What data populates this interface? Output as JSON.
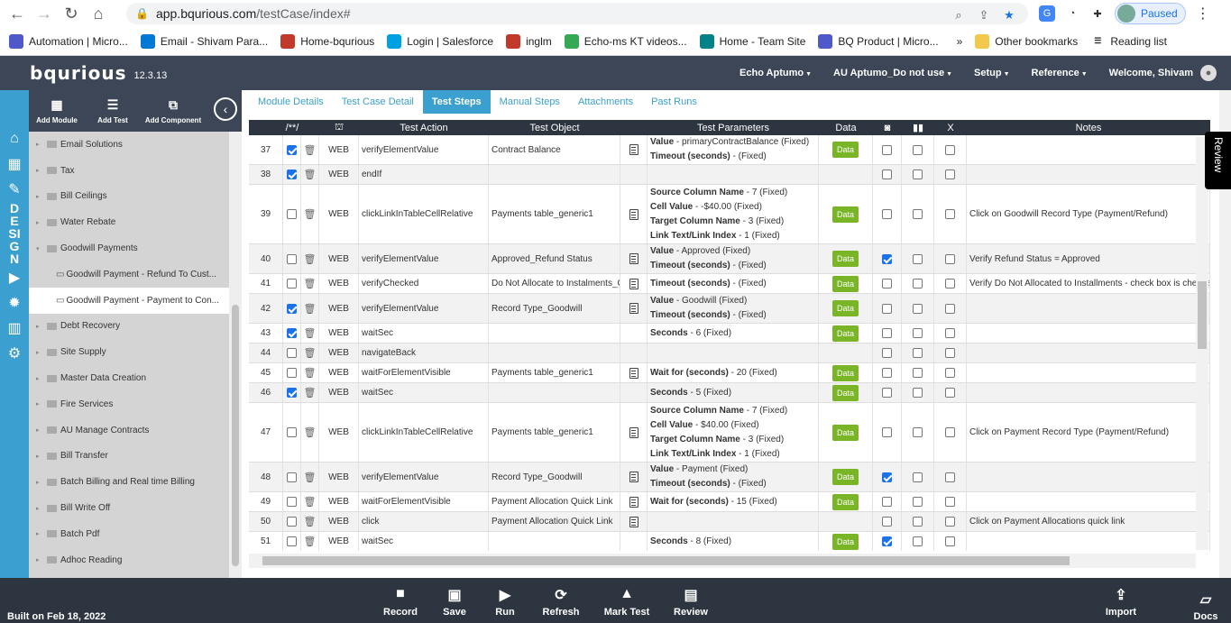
{
  "browser": {
    "url_host": "app.bqurious.com",
    "url_path": "/testCase/index#",
    "paused_label": "Paused"
  },
  "bookmarks": [
    {
      "label": "Automation | Micro...",
      "color": "#5059c9"
    },
    {
      "label": "Email - Shivam Para...",
      "color": "#0078d4"
    },
    {
      "label": "Home-bqurious",
      "color": "#c0392b"
    },
    {
      "label": "Login | Salesforce",
      "color": "#00a1e0"
    },
    {
      "label": "inglm",
      "color": "#c0392b"
    },
    {
      "label": "Echo-ms KT videos...",
      "color": "#34a853"
    },
    {
      "label": "Home - Team Site",
      "color": "#038387"
    },
    {
      "label": "BQ Product | Micro...",
      "color": "#5059c9"
    }
  ],
  "bookmarks_extra": {
    "more": "»",
    "other": "Other bookmarks",
    "reading": "Reading list"
  },
  "app": {
    "logo": "bqurious",
    "version": "12.3.13",
    "nav": [
      "Echo Aptumo",
      "AU Aptumo_Do not use",
      "Setup",
      "Reference"
    ],
    "welcome": "Welcome, Shivam"
  },
  "sidetools": {
    "add_module": "Add Module",
    "add_test": "Add Test",
    "add_component": "Add Component"
  },
  "design_label": [
    "D",
    "E",
    "SI",
    "G",
    "N"
  ],
  "tree": [
    {
      "label": "Email Solutions",
      "child": false
    },
    {
      "label": "Tax",
      "child": false
    },
    {
      "label": "Bill Ceilings",
      "child": false
    },
    {
      "label": "Water Rebate",
      "child": false
    },
    {
      "label": "Goodwill Payments",
      "child": false,
      "open": true
    },
    {
      "label": "Goodwill Payment - Refund To Cust...",
      "child": true
    },
    {
      "label": "Goodwill Payment - Payment to Con...",
      "child": true,
      "selected": true
    },
    {
      "label": "Debt Recovery",
      "child": false
    },
    {
      "label": "Site Supply",
      "child": false
    },
    {
      "label": "Master Data Creation",
      "child": false
    },
    {
      "label": "Fire Services",
      "child": false
    },
    {
      "label": "AU Manage Contracts",
      "child": false
    },
    {
      "label": "Bill Transfer",
      "child": false
    },
    {
      "label": "Batch Billing and Real time Billing",
      "child": false
    },
    {
      "label": "Bill Write Off",
      "child": false
    },
    {
      "label": "Batch Pdf",
      "child": false
    },
    {
      "label": "Adhoc Reading",
      "child": false
    }
  ],
  "tabs": [
    "Module Details",
    "Test Case Detail",
    "Test Steps",
    "Manual Steps",
    "Attachments",
    "Past Runs"
  ],
  "active_tab": 2,
  "grid": {
    "headers": [
      "",
      "/**/",
      "",
      "",
      "Test Action",
      "Test Object",
      "",
      "Test Parameters",
      "Data",
      "",
      "",
      "X",
      "Notes"
    ],
    "rows": [
      {
        "n": "37",
        "chk": true,
        "type": "WEB",
        "action": "verifyElementValue",
        "object": "Contract Balance",
        "doc": true,
        "params": [
          [
            "Value",
            "primaryContractBalance (Fixed)"
          ],
          [
            "Timeout (seconds)",
            "(Fixed)"
          ]
        ],
        "data": true,
        "cam": false,
        "notes": ""
      },
      {
        "n": "38",
        "chk": true,
        "type": "WEB",
        "action": "endIf",
        "object": "",
        "doc": false,
        "params": [],
        "data": false,
        "cam": false,
        "notes": ""
      },
      {
        "n": "39",
        "chk": false,
        "type": "WEB",
        "action": "clickLinkInTableCellRelative",
        "object": "Payments table_generic1",
        "doc": true,
        "params": [
          [
            "Source Column Name",
            "7 (Fixed)"
          ],
          [
            "Cell Value",
            "-$40.00 (Fixed)"
          ],
          [
            "Target Column Name",
            "3 (Fixed)"
          ],
          [
            "Link Text/Link Index",
            "1 (Fixed)"
          ]
        ],
        "data": true,
        "cam": false,
        "notes": "Click on Goodwill Record Type (Payment/Refund)"
      },
      {
        "n": "40",
        "chk": false,
        "type": "WEB",
        "action": "verifyElementValue",
        "object": "Approved_Refund Status",
        "doc": true,
        "params": [
          [
            "Value",
            "Approved (Fixed)"
          ],
          [
            "Timeout (seconds)",
            "(Fixed)"
          ]
        ],
        "data": true,
        "cam": true,
        "notes": "Verify Refund Status = Approved"
      },
      {
        "n": "41",
        "chk": false,
        "type": "WEB",
        "action": "verifyChecked",
        "object": "Do Not Allocate to Instalments_Goodwill",
        "doc": true,
        "params": [
          [
            "Timeout (seconds)",
            "(Fixed)"
          ]
        ],
        "data": true,
        "cam": false,
        "notes": "Verify Do Not Allocated to Installments - check box is checked"
      },
      {
        "n": "42",
        "chk": true,
        "type": "WEB",
        "action": "verifyElementValue",
        "object": "Record Type_Goodwill",
        "doc": true,
        "params": [
          [
            "Value",
            "Goodwill (Fixed)"
          ],
          [
            "Timeout (seconds)",
            "(Fixed)"
          ]
        ],
        "data": true,
        "cam": false,
        "notes": ""
      },
      {
        "n": "43",
        "chk": true,
        "type": "WEB",
        "action": "waitSec",
        "object": "",
        "doc": false,
        "params": [
          [
            "Seconds",
            "6 (Fixed)"
          ]
        ],
        "data": true,
        "cam": false,
        "notes": ""
      },
      {
        "n": "44",
        "chk": false,
        "type": "WEB",
        "action": "navigateBack",
        "object": "",
        "doc": false,
        "params": [],
        "data": false,
        "cam": false,
        "notes": ""
      },
      {
        "n": "45",
        "chk": false,
        "type": "WEB",
        "action": "waitForElementVisible",
        "object": "Payments table_generic1",
        "doc": true,
        "params": [
          [
            "Wait for (seconds)",
            "20 (Fixed)"
          ]
        ],
        "data": true,
        "cam": false,
        "notes": ""
      },
      {
        "n": "46",
        "chk": true,
        "type": "WEB",
        "action": "waitSec",
        "object": "",
        "doc": false,
        "params": [
          [
            "Seconds",
            "5 (Fixed)"
          ]
        ],
        "data": true,
        "cam": false,
        "notes": ""
      },
      {
        "n": "47",
        "chk": false,
        "type": "WEB",
        "action": "clickLinkInTableCellRelative",
        "object": "Payments table_generic1",
        "doc": true,
        "params": [
          [
            "Source Column Name",
            "7 (Fixed)"
          ],
          [
            "Cell Value",
            "$40.00 (Fixed)"
          ],
          [
            "Target Column Name",
            "3 (Fixed)"
          ],
          [
            "Link Text/Link Index",
            "1 (Fixed)"
          ]
        ],
        "data": true,
        "cam": false,
        "notes": "Click on Payment Record Type (Payment/Refund)"
      },
      {
        "n": "48",
        "chk": false,
        "type": "WEB",
        "action": "verifyElementValue",
        "object": "Record Type_Goodwill",
        "doc": true,
        "params": [
          [
            "Value",
            "Payment (Fixed)"
          ],
          [
            "Timeout (seconds)",
            "(Fixed)"
          ]
        ],
        "data": true,
        "cam": true,
        "notes": ""
      },
      {
        "n": "49",
        "chk": false,
        "type": "WEB",
        "action": "waitForElementVisible",
        "object": "Payment Allocation Quick Link",
        "doc": true,
        "params": [
          [
            "Wait for (seconds)",
            "15 (Fixed)"
          ]
        ],
        "data": true,
        "cam": false,
        "notes": ""
      },
      {
        "n": "50",
        "chk": false,
        "type": "WEB",
        "action": "click",
        "object": "Payment Allocation Quick Link",
        "doc": true,
        "params": [],
        "data": false,
        "cam": false,
        "notes": "Click on Payment Allocations quick link"
      },
      {
        "n": "51",
        "chk": false,
        "type": "WEB",
        "action": "waitSec",
        "object": "",
        "doc": false,
        "params": [
          [
            "Seconds",
            "8 (Fixed)"
          ]
        ],
        "data": true,
        "cam": true,
        "notes": ""
      }
    ]
  },
  "data_label": "Data",
  "review_label": "Review",
  "footer": {
    "built": "Built on Feb 18, 2022",
    "buttons": [
      "Record",
      "Save",
      "Run",
      "Refresh",
      "Mark Test",
      "Review"
    ],
    "import": "Import",
    "docs": "Docs"
  }
}
